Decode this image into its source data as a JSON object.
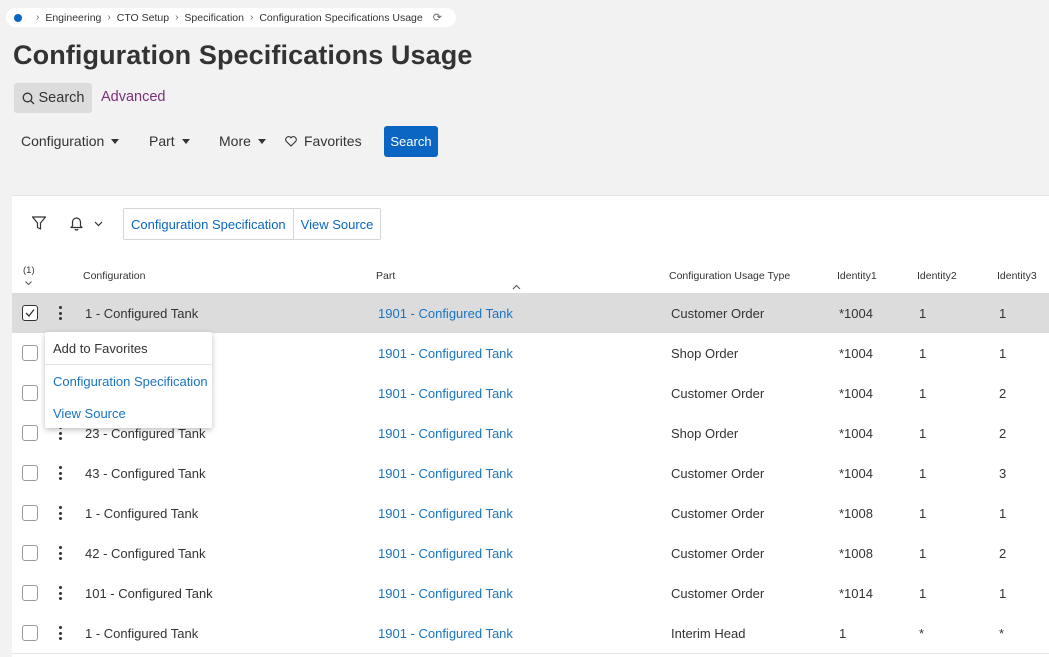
{
  "breadcrumb": {
    "items": [
      "Engineering",
      "CTO Setup",
      "Specification",
      "Configuration Specifications Usage"
    ]
  },
  "page_title": "Configuration Specifications Usage",
  "search_tabs": {
    "search": "Search",
    "advanced": "Advanced"
  },
  "filters": {
    "configuration": "Configuration",
    "part": "Part",
    "more": "More",
    "favorites": "Favorites",
    "search_button": "Search"
  },
  "toolbar": {
    "config_spec_button": "Configuration Specification",
    "view_source_button": "View Source"
  },
  "table": {
    "selected_count": "(1)",
    "columns": [
      "Configuration",
      "Part",
      "Configuration Usage Type",
      "Identity1",
      "Identity2",
      "Identity3"
    ],
    "rows": [
      {
        "configuration": "1 - Configured Tank",
        "part": "1901 - Configured Tank",
        "usage_type": "Customer Order",
        "identity1": "*1004",
        "identity2": "1",
        "identity3": "1",
        "selected": true
      },
      {
        "configuration": "",
        "part": "1901 - Configured Tank",
        "usage_type": "Shop Order",
        "identity1": "*1004",
        "identity2": "1",
        "identity3": "1",
        "selected": false
      },
      {
        "configuration": "",
        "part": "1901 - Configured Tank",
        "usage_type": "Customer Order",
        "identity1": "*1004",
        "identity2": "1",
        "identity3": "2",
        "selected": false
      },
      {
        "configuration": "23 - Configured Tank",
        "part": "1901 - Configured Tank",
        "usage_type": "Shop Order",
        "identity1": "*1004",
        "identity2": "1",
        "identity3": "2",
        "selected": false
      },
      {
        "configuration": "43 - Configured Tank",
        "part": "1901 - Configured Tank",
        "usage_type": "Customer Order",
        "identity1": "*1004",
        "identity2": "1",
        "identity3": "3",
        "selected": false
      },
      {
        "configuration": "1 - Configured Tank",
        "part": "1901 - Configured Tank",
        "usage_type": "Customer Order",
        "identity1": "*1008",
        "identity2": "1",
        "identity3": "1",
        "selected": false
      },
      {
        "configuration": "42 - Configured Tank",
        "part": "1901 - Configured Tank",
        "usage_type": "Customer Order",
        "identity1": "*1008",
        "identity2": "1",
        "identity3": "2",
        "selected": false
      },
      {
        "configuration": "101 - Configured Tank",
        "part": "1901 - Configured Tank",
        "usage_type": "Customer Order",
        "identity1": "*1014",
        "identity2": "1",
        "identity3": "1",
        "selected": false
      },
      {
        "configuration": "1 - Configured Tank",
        "part": "1901 - Configured Tank",
        "usage_type": "Interim Head",
        "identity1": "1",
        "identity2": "*",
        "identity3": "*",
        "selected": false
      }
    ]
  },
  "context_menu": {
    "add_to_favorites": "Add to Favorites",
    "configuration_specification": "Configuration Specification",
    "view_source": "View Source"
  },
  "colors": {
    "accent": "#0a66c2",
    "link": "#1a74c4",
    "advanced": "#7a2f7a",
    "selected_row": "#dcdcdc"
  }
}
